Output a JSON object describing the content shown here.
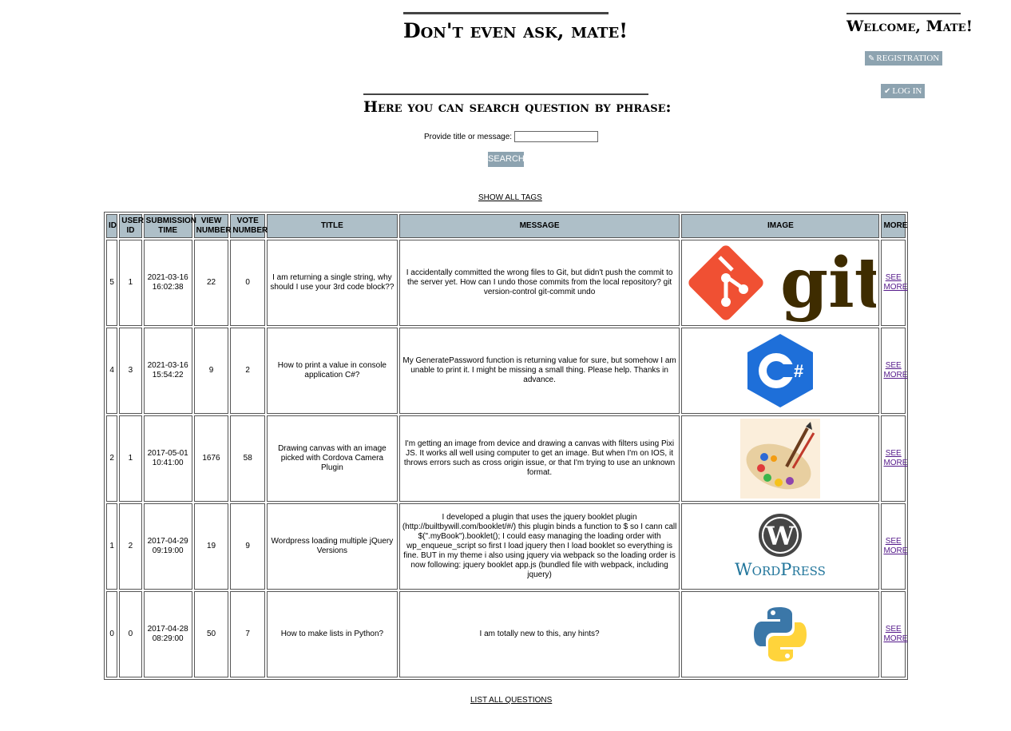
{
  "header": {
    "site_title": "Don't even ask, mate!",
    "welcome": "Welcome, Mate!",
    "registration_label": "REGISTRATION",
    "login_label": "LOG IN"
  },
  "search": {
    "heading": "Here you can search question by phrase:",
    "field_label": "Provide title or message:",
    "input_value": "",
    "button_label": "SEARCH"
  },
  "links": {
    "show_all_tags": "SHOW ALL TAGS",
    "list_all_questions": "LIST ALL QUESTIONS"
  },
  "table": {
    "headers": {
      "id": "ID",
      "user_id": "USER ID",
      "submission_time": "SUBMISSION TIME",
      "view_number": "VIEW NUMBER",
      "vote_number": "VOTE NUMBER",
      "title": "TITLE",
      "message": "MESSAGE",
      "image": "IMAGE",
      "more": "MORE"
    },
    "rows": [
      {
        "id": "5",
        "user_id": "1",
        "submission_time": "2021-03-16 16:02:38",
        "view_number": "22",
        "vote_number": "0",
        "title": "I am returning a single string, why should I use your 3rd code block??",
        "message": "I accidentally committed the wrong files to Git, but didn't push the commit to the server yet. How can I undo those commits from the local repository? git version-control git-commit undo",
        "image_icon": "git-logo",
        "image_text": "git",
        "more": "SEE MORE"
      },
      {
        "id": "4",
        "user_id": "3",
        "submission_time": "2021-03-16 15:54:22",
        "view_number": "9",
        "vote_number": "2",
        "title": "How to print a value in console application C#?",
        "message": "My GeneratePassword function is returning value for sure, but somehow I am unable to print it. I might be missing a small thing. Please help. Thanks in advance.",
        "image_icon": "csharp-logo",
        "image_text": "C#",
        "more": "SEE MORE"
      },
      {
        "id": "2",
        "user_id": "1",
        "submission_time": "2017-05-01 10:41:00",
        "view_number": "1676",
        "vote_number": "58",
        "title": "Drawing canvas with an image picked with Cordova Camera Plugin",
        "message": "I'm getting an image from device and drawing a canvas with filters using Pixi JS. It works all well using computer to get an image. But when I'm on IOS, it throws errors such as cross origin issue, or that I'm trying to use an unknown format.",
        "image_icon": "paint-palette",
        "more": "SEE MORE"
      },
      {
        "id": "1",
        "user_id": "2",
        "submission_time": "2017-04-29 09:19:00",
        "view_number": "19",
        "vote_number": "9",
        "title": "Wordpress loading multiple jQuery Versions",
        "message": "I developed a plugin that uses the jquery booklet plugin (http://builtbywill.com/booklet/#/) this plugin binds a function to $ so I cann call $(\".myBook\").booklet(); I could easy managing the loading order with wp_enqueue_script so first I load jquery then I load booklet so everything is fine. BUT in my theme i also using jquery via webpack so the loading order is now following: jquery booklet app.js (bundled file with webpack, including jquery)",
        "image_icon": "wordpress-logo",
        "image_text": "WordPress",
        "more": "SEE MORE"
      },
      {
        "id": "0",
        "user_id": "0",
        "submission_time": "2017-04-28 08:29:00",
        "view_number": "50",
        "vote_number": "7",
        "title": "How to make lists in Python?",
        "message": "I am totally new to this, any hints?",
        "image_icon": "python-logo",
        "more": "SEE MORE"
      }
    ]
  }
}
